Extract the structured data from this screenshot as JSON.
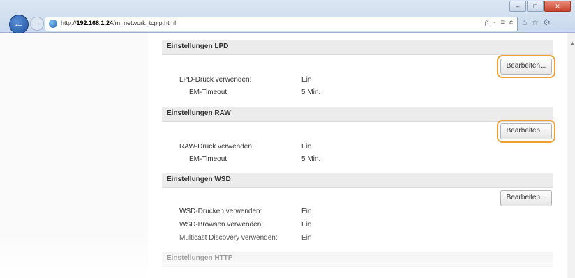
{
  "browser": {
    "url_prefix": "http://",
    "url_host": "192.168.1.24",
    "url_path": "/m_network_tcpip.html",
    "search_tools": "ρ - ≡ c"
  },
  "sections": [
    {
      "title": "Einstellungen LPD",
      "button": "Bearbeiten...",
      "rows": [
        {
          "label": "LPD-Druck verwenden:",
          "value": "Ein"
        },
        {
          "label": "EM-Timeout",
          "value": "5 Min."
        }
      ]
    },
    {
      "title": "Einstellungen RAW",
      "button": "Bearbeiten...",
      "rows": [
        {
          "label": "RAW-Druck verwenden:",
          "value": "Ein"
        },
        {
          "label": "EM-Timeout",
          "value": "5 Min."
        }
      ]
    },
    {
      "title": "Einstellungen WSD",
      "button": "Bearbeiten...",
      "rows": [
        {
          "label": "WSD-Drucken verwenden:",
          "value": "Ein"
        },
        {
          "label": "WSD-Browsen verwenden:",
          "value": "Ein"
        },
        {
          "label": "Multicast Discovery verwenden:",
          "value": "Ein"
        }
      ]
    },
    {
      "title": "Einstellungen HTTP"
    }
  ]
}
